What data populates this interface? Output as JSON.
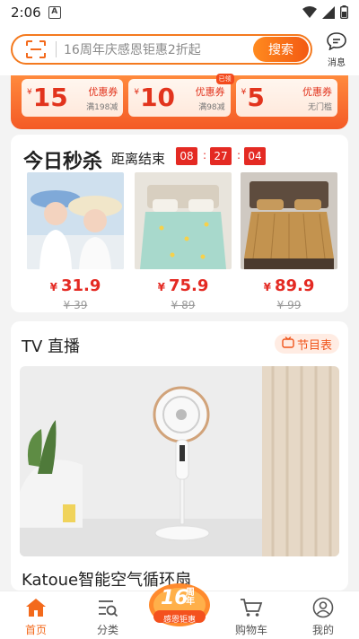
{
  "status": {
    "time": "2:06",
    "badge": "A"
  },
  "search": {
    "placeholder": "16周年庆感恩钜惠2折起",
    "button": "搜索"
  },
  "message": {
    "label": "消息"
  },
  "coupons": [
    {
      "amount": "15",
      "title": "优惠券",
      "cond": "满198减",
      "tag": ""
    },
    {
      "amount": "10",
      "title": "优惠券",
      "cond": "满98减",
      "tag": "已领"
    },
    {
      "amount": "5",
      "title": "优惠券",
      "cond": "无门槛",
      "tag": ""
    }
  ],
  "flash": {
    "title": "今日秒杀",
    "countdown_label": "距离结束",
    "hours": "08",
    "minutes": "27",
    "seconds": "04",
    "products": [
      {
        "price": "31.9",
        "old": "¥ 39",
        "currency": "¥"
      },
      {
        "price": "75.9",
        "old": "¥ 89",
        "currency": "¥"
      },
      {
        "price": "89.9",
        "old": "¥ 99",
        "currency": "¥"
      }
    ]
  },
  "tv": {
    "title": "TV 直播",
    "schedule": "节目表",
    "product_title": "Katoue智能空气循环扇"
  },
  "nav": [
    {
      "label": "首页",
      "icon": "home-icon"
    },
    {
      "label": "分类",
      "icon": "category-search-icon"
    },
    {
      "label": "",
      "icon": "anniversary-badge"
    },
    {
      "label": "购物车",
      "icon": "cart-icon"
    },
    {
      "label": "我的",
      "icon": "profile-icon"
    }
  ],
  "anniversary": {
    "line1": "16",
    "line2": "周年",
    "line3": "感恩钜惠"
  },
  "colors": {
    "accent": "#f36a1c",
    "price": "#e42a23"
  }
}
